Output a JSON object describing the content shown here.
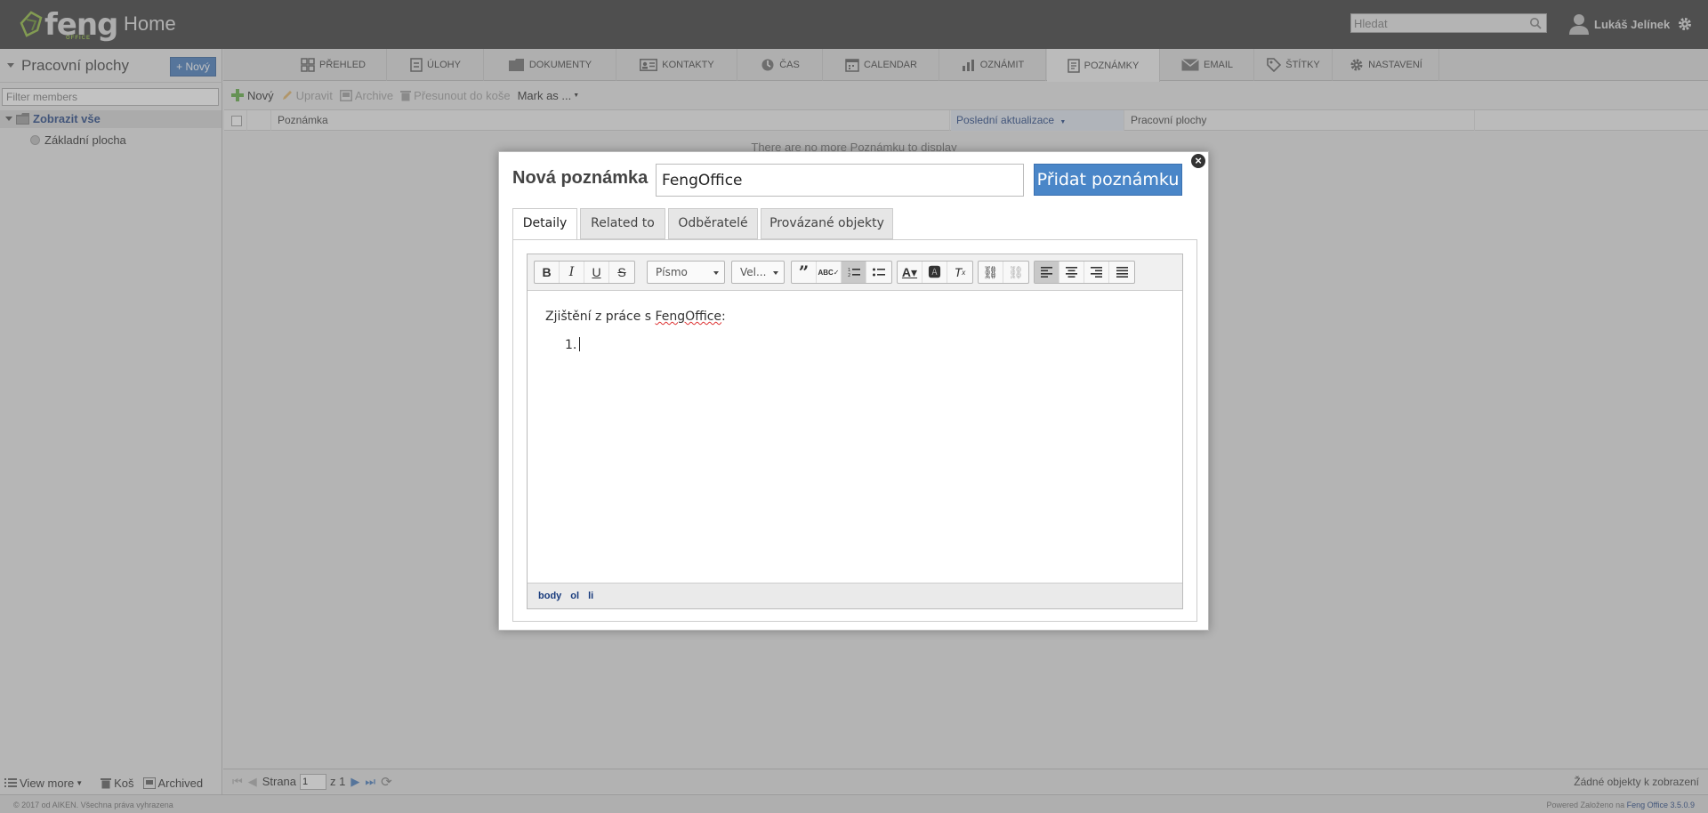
{
  "header": {
    "logo_text": "feng",
    "logo_sub": "OFFICE",
    "home_title": "Home",
    "search_placeholder": "Hledat",
    "user_name": "Lukáš Jelínek"
  },
  "left_panel": {
    "title": "Pracovní plochy",
    "new_button": "+ Nový",
    "filter_placeholder": "Filter members",
    "tree_root": "Zobrazit vše",
    "tree_child": "Základní plocha",
    "footer": {
      "view_more": "View more",
      "trash": "Koš",
      "archived": "Archived"
    }
  },
  "tabs": [
    {
      "label": "PŘEHLED",
      "icon": "dashboard-icon"
    },
    {
      "label": "ÚLOHY",
      "icon": "tasks-icon"
    },
    {
      "label": "DOKUMENTY",
      "icon": "folder-icon"
    },
    {
      "label": "KONTAKTY",
      "icon": "contact-card-icon"
    },
    {
      "label": "ČAS",
      "icon": "clock-icon"
    },
    {
      "label": "CALENDAR",
      "icon": "calendar-icon"
    },
    {
      "label": "OZNÁMIT",
      "icon": "chart-icon"
    },
    {
      "label": "POZNÁMKY",
      "icon": "note-icon",
      "active": true
    },
    {
      "label": "EMAIL",
      "icon": "envelope-icon"
    },
    {
      "label": "ŠTÍTKY",
      "icon": "tag-icon"
    },
    {
      "label": "NASTAVENÍ",
      "icon": "gear-icon"
    }
  ],
  "toolbar": {
    "new": "Nový",
    "edit": "Upravit",
    "archive": "Archive",
    "trash": "Přesunout do koše",
    "mark_as": "Mark as ..."
  },
  "grid": {
    "columns": [
      "Poznámka",
      "Poslední aktualizace",
      "Pracovní plochy"
    ],
    "empty_message": "There are no more Poznámku to display"
  },
  "pager": {
    "page_label": "Strana",
    "page_value": "1",
    "of_label": "z 1",
    "status": "Žádné objekty k zobrazení"
  },
  "footer": {
    "copyright": "© 2017 od AIKEN. Všechna práva vyhrazena",
    "powered_prefix": "Powered Založeno na",
    "powered_brand": "Feng Office 3.5.0.9"
  },
  "modal": {
    "title": "Nová poznámka",
    "name_value": "FengOffice",
    "add_button": "Přidat poznámku",
    "close": "×",
    "tabs": [
      "Detaily",
      "Related to",
      "Odběratelé",
      "Provázané objekty"
    ],
    "editor": {
      "font_combo": "Písmo",
      "size_combo": "Vel...",
      "line1_prefix": "Zjištění z práce s ",
      "line1_word": "FengOffice",
      "line1_suffix": ":",
      "list_marker": "1.",
      "path": [
        "body",
        "ol",
        "li"
      ]
    }
  }
}
